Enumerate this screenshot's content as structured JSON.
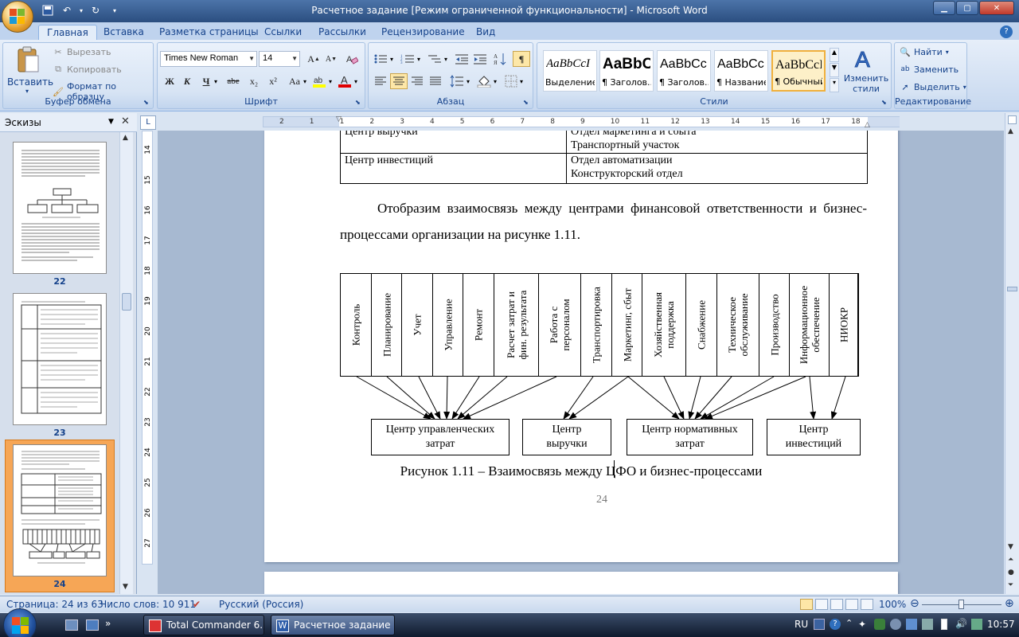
{
  "window": {
    "title": "Расчетное задание [Режим ограниченной функциональности] - Microsoft Word"
  },
  "ribbon_tabs": [
    "Главная",
    "Вставка",
    "Разметка страницы",
    "Ссылки",
    "Рассылки",
    "Рецензирование",
    "Вид"
  ],
  "clipboard": {
    "paste": "Вставить",
    "cut": "Вырезать",
    "copy": "Копировать",
    "format_painter": "Формат по образцу",
    "label": "Буфер обмена"
  },
  "font": {
    "family": "Times New Roman",
    "size": "14",
    "label": "Шрифт",
    "bold": "Ж",
    "italic": "К",
    "underline": "Ч",
    "strike": "abe",
    "subscript": "x₂",
    "superscript": "x²",
    "case": "Aa"
  },
  "paragraph": {
    "label": "Абзац"
  },
  "styles": {
    "label": "Стили",
    "items": [
      {
        "sample": "AaBbCcI",
        "name": "Выделение"
      },
      {
        "sample": "AaBbC",
        "name": "¶ Заголов..."
      },
      {
        "sample": "AaBbCc",
        "name": "¶ Заголов..."
      },
      {
        "sample": "AaBbCc",
        "name": "¶ Название"
      },
      {
        "sample": "AaBbCcI",
        "name": "¶ Обычный"
      }
    ],
    "change": "Изменить стили"
  },
  "editing": {
    "label": "Редактирование",
    "find": "Найти",
    "replace": "Заменить",
    "select": "Выделить"
  },
  "thumbnails": {
    "title": "Эскизы",
    "pages": [
      "22",
      "23",
      "24"
    ]
  },
  "hruler_ticks": [
    "2",
    "1",
    "1",
    "2",
    "3",
    "4",
    "5",
    "6",
    "7",
    "8",
    "9",
    "10",
    "11",
    "12",
    "13",
    "14",
    "15",
    "16",
    "17",
    "18"
  ],
  "vruler_ticks": [
    "14",
    "15",
    "16",
    "17",
    "18",
    "19",
    "20",
    "21",
    "22",
    "23",
    "24",
    "25",
    "26",
    "27"
  ],
  "document": {
    "table_rows": [
      {
        "center": "Центр выручки",
        "units": [
          "Отдел маркетинга и сбыта",
          "Транспортный участок"
        ]
      },
      {
        "center": "Центр инвестиций",
        "units": [
          "Отдел автоматизации",
          "Конструкторский отдел"
        ]
      }
    ],
    "paragraph": "Отобразим взаимосвязь между центрами финансовой ответственности и бизнес-процессами организации на рисунке 1.11.",
    "processes": [
      "Контроль",
      "Планирование",
      "Учет",
      "Управление",
      "Ремонт",
      "Расчет затрат и\nфин. результата",
      "Работа с\nперсоналом",
      "Транспортировка",
      "Маркетинг, сбыт",
      "Хозяйственная\nподдержка",
      "Снабжение",
      "Техническое\nобслуживание",
      "Производство",
      "Информационное\nобеспечение",
      "НИОКР"
    ],
    "centers": [
      "Центр управленческих\nзатрат",
      "Центр\nвыручки",
      "Центр нормативных\nзатрат",
      "Центр\nинвестиций"
    ],
    "caption": "Рисунок 1.11 – Взаимосвязь между ЦФО и бизнес-процессами",
    "page_number": "24"
  },
  "status": {
    "page": "Страница: 24 из 63",
    "words": "Число слов: 10 911",
    "language": "Русский (Россия)",
    "zoom": "100%"
  },
  "taskbar": {
    "tasks": [
      "Total Commander 6....",
      "Расчетное задание ..."
    ],
    "lang": "RU",
    "time": "10:57"
  }
}
